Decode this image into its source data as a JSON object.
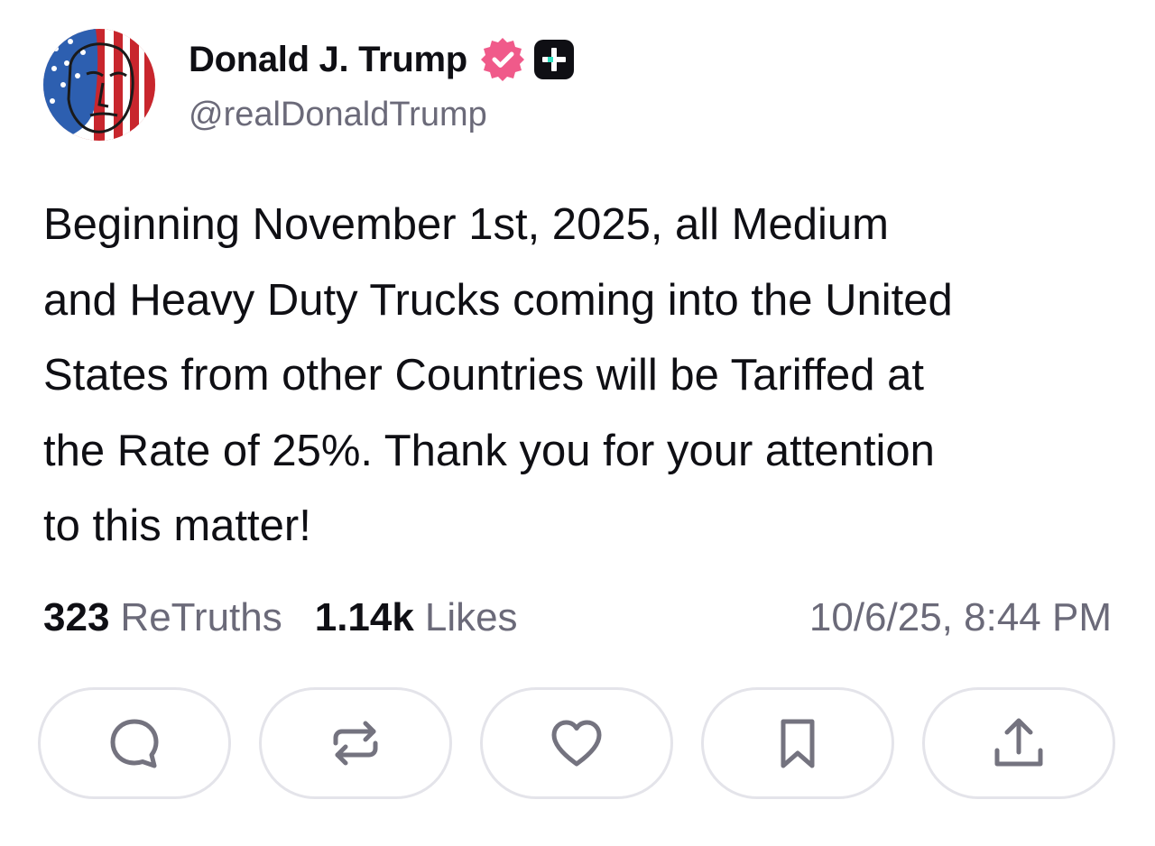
{
  "author": {
    "display_name": "Donald J. Trump",
    "handle": "@realDonaldTrump",
    "verified_color": "#f05a8a",
    "plus_badge_color": "#0f0f14",
    "plus_badge_accent": "#2fe0c0"
  },
  "post": {
    "text": "Beginning November 1st, 2025, all Medium\nand Heavy Duty Trucks coming into the United\nStates from other Countries will be Tariffed at\nthe Rate of 25%. Thank you for your attention\nto this matter!"
  },
  "stats": {
    "retruths_count": "323",
    "retruths_label": "ReTruths",
    "likes_count": "1.14k",
    "likes_label": "Likes",
    "timestamp": "10/6/25, 8:44 PM"
  },
  "actions": [
    {
      "icon": "reply-icon"
    },
    {
      "icon": "retruth-icon"
    },
    {
      "icon": "like-icon"
    },
    {
      "icon": "bookmark-icon"
    },
    {
      "icon": "share-icon"
    }
  ],
  "colors": {
    "text_primary": "#0f0f14",
    "text_secondary": "#6b6a79",
    "button_border": "#e4e4ea",
    "icon_gray": "#74737f"
  }
}
